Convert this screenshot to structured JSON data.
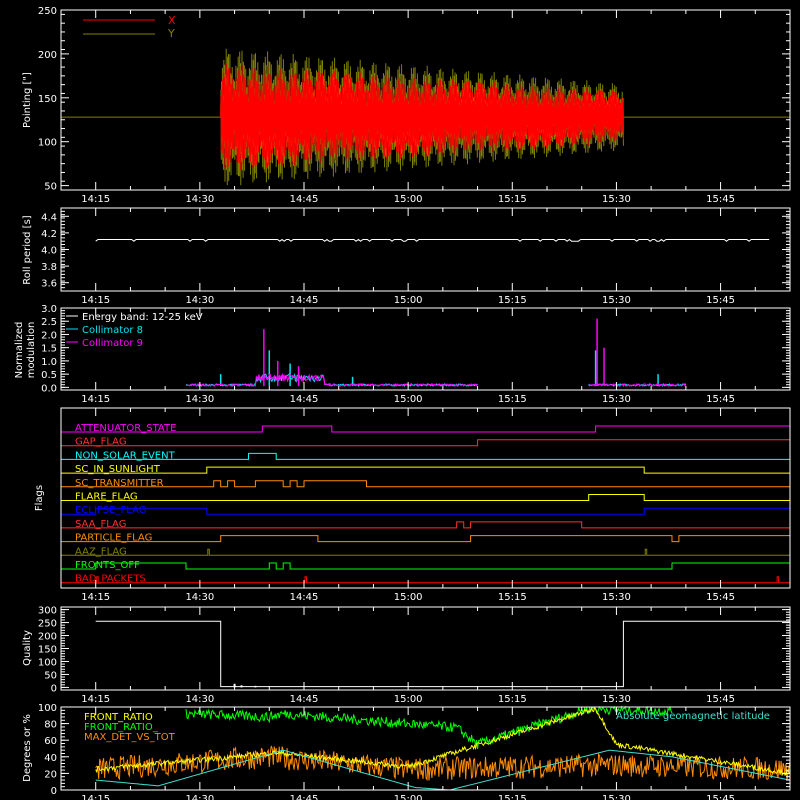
{
  "colors": {
    "background": "#000000",
    "axis": "#ffffff",
    "x_series": "#ff0000",
    "y_series": "#808000",
    "energy": "#ffffff",
    "coll8": "#00e5ee",
    "coll9": "#ff00ff",
    "front_ratio": "#ffff00",
    "front_ratio_alt": "#00ff00",
    "max_det": "#ff8c00",
    "magnetic_latitude": "#40e0d0"
  },
  "time_ticks": [
    "14:15",
    "14:30",
    "14:45",
    "15:00",
    "15:15",
    "15:30",
    "15:45"
  ],
  "panels": {
    "pointing": {
      "ylabel": "Pointing [\"]",
      "yticks": [
        "50",
        "100",
        "150",
        "200",
        "250"
      ],
      "legend": [
        {
          "name": "X",
          "color": "#ff0000"
        },
        {
          "name": "Y",
          "color": "#808000"
        }
      ]
    },
    "roll": {
      "ylabel": "Roll period [s]",
      "yticks": [
        "3.6",
        "3.8",
        "4.0",
        "4.2",
        "4.4"
      ]
    },
    "modulation": {
      "ylabel_line1": "Normalized",
      "ylabel_line2": "modulation",
      "yticks": [
        "0.0",
        "0.5",
        "1.0",
        "1.5",
        "2.0",
        "2.5",
        "3.0"
      ],
      "legend": [
        {
          "name": "Energy band: 12-25 keV",
          "color": "#ffffff"
        },
        {
          "name": "Collimator 8",
          "color": "#00e5ee"
        },
        {
          "name": "Collimator 9",
          "color": "#ff00ff"
        }
      ]
    },
    "flags": {
      "ylabel": "Flags",
      "items": [
        {
          "name": "ATTENUATOR_STATE",
          "color": "#ff00ff"
        },
        {
          "name": "GAP_FLAG",
          "color": "#ff3030"
        },
        {
          "name": "NON_SOLAR_EVENT",
          "color": "#00ffff"
        },
        {
          "name": "SC_IN_SUNLIGHT",
          "color": "#ffff00"
        },
        {
          "name": "SC_TRANSMITTER",
          "color": "#ff8c00"
        },
        {
          "name": "FLARE_FLAG",
          "color": "#ffff00"
        },
        {
          "name": "ECLIPSE_FLAG",
          "color": "#0000ff"
        },
        {
          "name": "SAA_FLAG",
          "color": "#ff3030"
        },
        {
          "name": "PARTICLE_FLAG",
          "color": "#ff8c00"
        },
        {
          "name": "AAZ_FLAG",
          "color": "#808000"
        },
        {
          "name": "FRONTS_OFF",
          "color": "#00ff00"
        },
        {
          "name": "BAD_PACKETS",
          "color": "#ff0000"
        }
      ]
    },
    "quality": {
      "ylabel": "Quality",
      "yticks": [
        "0",
        "50",
        "100",
        "150",
        "200",
        "250",
        "300"
      ]
    },
    "degrees": {
      "ylabel": "Degrees or %",
      "yticks": [
        "0",
        "20",
        "40",
        "60",
        "80",
        "100"
      ],
      "legend": [
        {
          "name": "FRONT_RATIO",
          "color": "#ffff00"
        },
        {
          "name": "FRONT_RATIO_",
          "color": "#00ff00"
        },
        {
          "name": "MAX_DET_VS_TOT",
          "color": "#ff8c00"
        }
      ],
      "right_label": "Absolute geomagnetic latitude"
    }
  },
  "chart_data": [
    {
      "type": "line",
      "xlabel": "",
      "ylabel": "Pointing [\"]",
      "x_range": [
        "14:15",
        "15:55"
      ],
      "ylim": [
        45,
        250
      ],
      "series": [
        {
          "name": "X",
          "segments": [
            {
              "start": "14:33",
              "end": "15:31",
              "mean": 128,
              "amplitude_start": 62,
              "amplitude_end": 30,
              "max": 190,
              "min": 62
            }
          ]
        },
        {
          "name": "Y",
          "segments": [
            {
              "start": "14:33",
              "end": "15:31",
              "mean": 128,
              "amplitude_start": 80,
              "amplitude_end": 38,
              "max": 212,
              "min": 80
            }
          ]
        }
      ],
      "reference_line": 128
    },
    {
      "type": "line",
      "ylabel": "Roll period [s]",
      "ylim": [
        3.5,
        4.5
      ],
      "series": [
        {
          "name": "",
          "constant": 4.12,
          "start": "14:15",
          "end": "15:52"
        }
      ]
    },
    {
      "type": "line",
      "ylabel": "Normalized modulation",
      "ylim": [
        -0.1,
        3.0
      ],
      "series": [
        {
          "name": "Collimator 8",
          "baseline": 0.05,
          "spikes": [
            {
              "t": "14:33",
              "v": 0.5
            },
            {
              "t": "14:40",
              "v": 1.4
            },
            {
              "t": "14:43",
              "v": 0.9
            },
            {
              "t": "14:52",
              "v": 0.4
            },
            {
              "t": "15:27",
              "v": 1.4
            },
            {
              "t": "15:36",
              "v": 0.5
            }
          ]
        },
        {
          "name": "Collimator 9",
          "baseline": 0.05,
          "spikes": [
            {
              "t": "14:39",
              "v": 2.2
            },
            {
              "t": "14:41",
              "v": 1.0
            },
            {
              "t": "14:44",
              "v": 0.8
            },
            {
              "t": "15:27",
              "v": 2.6
            },
            {
              "t": "15:28",
              "v": 1.5
            }
          ]
        }
      ]
    },
    {
      "type": "line",
      "ylabel": "Flags",
      "series": [
        {
          "name": "ATTENUATOR_STATE",
          "high": [
            [
              "14:39",
              "14:49"
            ],
            [
              "15:27",
              "15:55"
            ]
          ]
        },
        {
          "name": "GAP_FLAG",
          "high": [
            [
              "15:10",
              "15:55"
            ]
          ]
        },
        {
          "name": "NON_SOLAR_EVENT",
          "high": [
            [
              "14:37",
              "14:41"
            ]
          ]
        },
        {
          "name": "SC_IN_SUNLIGHT",
          "high": [
            [
              "14:31",
              "15:34"
            ]
          ]
        },
        {
          "name": "SC_TRANSMITTER",
          "high": [
            [
              "14:32",
              "14:33"
            ],
            [
              "14:34",
              "14:35"
            ],
            [
              "14:38",
              "14:42"
            ],
            [
              "14:43",
              "14:44"
            ],
            [
              "14:45",
              "14:54"
            ]
          ]
        },
        {
          "name": "FLARE_FLAG",
          "high": [
            [
              "15:26",
              "15:34"
            ]
          ]
        },
        {
          "name": "ECLIPSE_FLAG",
          "high": [
            [
              "14:15",
              "14:31"
            ],
            [
              "15:34",
              "15:55"
            ]
          ]
        },
        {
          "name": "SAA_FLAG",
          "high": [
            [
              "15:07",
              "15:08"
            ],
            [
              "15:09",
              "15:25"
            ]
          ]
        },
        {
          "name": "PARTICLE_FLAG",
          "high": [
            [
              "14:33",
              "14:47"
            ],
            [
              "15:09",
              "15:38"
            ],
            [
              "15:39",
              "15:55"
            ]
          ]
        },
        {
          "name": "AAZ_FLAG",
          "pulses": [
            "14:31",
            "15:34"
          ]
        },
        {
          "name": "FRONTS_OFF",
          "high": [
            [
              "14:15",
              "14:28"
            ],
            [
              "14:40",
              "14:41"
            ],
            [
              "14:42",
              "14:43"
            ],
            [
              "15:38",
              "15:55"
            ]
          ]
        },
        {
          "name": "BAD_PACKETS",
          "pulses": [
            "14:15",
            "14:45",
            "15:53"
          ]
        }
      ]
    },
    {
      "type": "line",
      "ylabel": "Quality",
      "ylim": [
        0,
        310
      ],
      "series": [
        {
          "name": "",
          "segments": [
            {
              "start": "14:15",
              "end": "14:33",
              "value": 255
            },
            {
              "start": "14:33",
              "end": "15:31",
              "value": 3
            },
            {
              "start": "15:31",
              "end": "15:55",
              "value": 255
            }
          ]
        }
      ]
    },
    {
      "type": "line",
      "ylabel": "Degrees or %",
      "ylim": [
        0,
        100
      ],
      "series": [
        {
          "name": "FRONT_RATIO",
          "approx": [
            [
              "14:15",
              25
            ],
            [
              "14:35",
              40
            ],
            [
              "14:41",
              45
            ],
            [
              "15:00",
              28
            ],
            [
              "15:27",
              98
            ],
            [
              "15:30",
              55
            ],
            [
              "15:55",
              20
            ]
          ]
        },
        {
          "name": "FRONT_RATIO_",
          "approx": [
            [
              "14:28",
              92
            ],
            [
              "14:40",
              88
            ],
            [
              "14:42",
              92
            ],
            [
              "15:07",
              75
            ],
            [
              "15:10",
              55
            ],
            [
              "15:26",
              98
            ],
            [
              "15:38",
              95
            ]
          ]
        },
        {
          "name": "MAX_DET_VS_TOT",
          "approx": [
            [
              "14:15",
              25
            ],
            [
              "14:40",
              40
            ],
            [
              "15:00",
              25
            ],
            [
              "15:30",
              30
            ],
            [
              "15:55",
              25
            ]
          ]
        },
        {
          "name": "Absolute geomagnetic latitude",
          "approx": [
            [
              "14:15",
              12
            ],
            [
              "14:24",
              5
            ],
            [
              "14:42",
              48
            ],
            [
              "15:01",
              3
            ],
            [
              "15:06",
              0
            ],
            [
              "15:29",
              48
            ],
            [
              "15:38",
              40
            ],
            [
              "15:55",
              12
            ]
          ]
        }
      ]
    }
  ]
}
